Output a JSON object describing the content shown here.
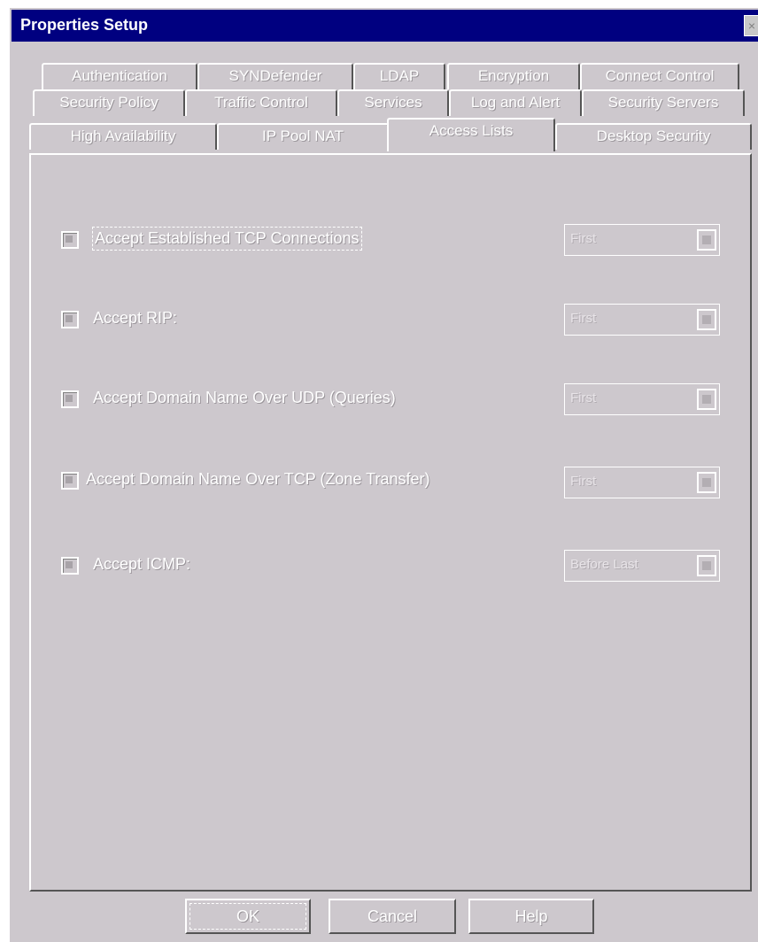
{
  "window": {
    "title": "Properties Setup",
    "close_label": "×"
  },
  "tabs": {
    "row1": [
      "Authentication",
      "SYNDefender",
      "LDAP",
      "Encryption",
      "Connect Control"
    ],
    "row2": [
      "Security Policy",
      "Traffic Control",
      "Services",
      "Log and Alert",
      "Security Servers"
    ],
    "row3": [
      "High Availability",
      "IP Pool NAT",
      "Access Lists",
      "Desktop Security"
    ],
    "active": "Access Lists"
  },
  "options": [
    {
      "label": "Accept Established TCP Connections",
      "checked": false,
      "value": "First"
    },
    {
      "label": "Accept RIP:",
      "checked": false,
      "value": "First"
    },
    {
      "label": "Accept Domain Name Over UDP (Queries)",
      "checked": false,
      "value": "First"
    },
    {
      "label": "Accept Domain Name Over TCP (Zone Transfer)",
      "checked": false,
      "value": "First"
    },
    {
      "label": "Accept ICMP:",
      "checked": false,
      "value": "Before Last"
    }
  ],
  "buttons": {
    "ok": "OK",
    "cancel": "Cancel",
    "help": "Help"
  }
}
